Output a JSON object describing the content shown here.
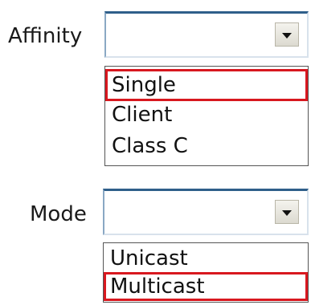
{
  "affinity": {
    "label": "Affinity",
    "value": "",
    "options": [
      "Single",
      "Client",
      "Class C"
    ],
    "highlighted": "Single"
  },
  "mode": {
    "label": "Mode",
    "value": "",
    "options": [
      "Unicast",
      "Multicast"
    ],
    "highlighted": "Multicast"
  },
  "colors": {
    "highlight_border": "#d8181f",
    "combo_border": "#2f5f8a"
  }
}
